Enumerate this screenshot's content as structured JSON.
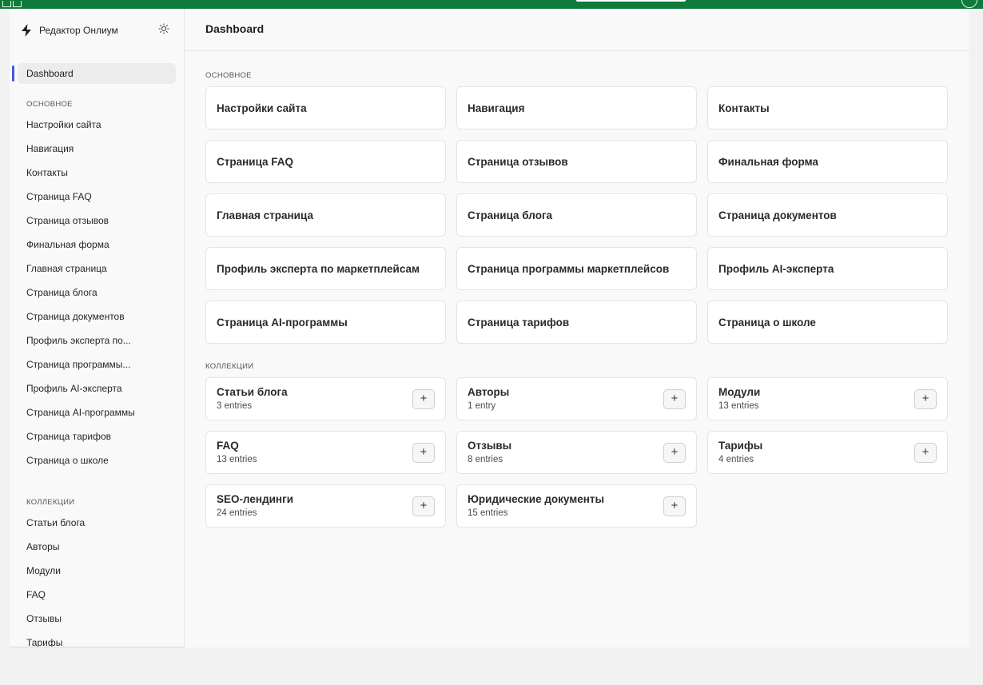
{
  "app": {
    "name": "Редактор Онлиум"
  },
  "header": {
    "title": "Dashboard"
  },
  "sidebar": {
    "active_item": "Dashboard",
    "section_main": "ОСНОВНОЕ",
    "main_items": [
      "Настройки сайта",
      "Навигация",
      "Контакты",
      "Страница FAQ",
      "Страница отзывов",
      "Финальная форма",
      "Главная страница",
      "Страница блога",
      "Страница документов",
      "Профиль эксперта по...",
      "Страница программы...",
      "Профиль AI-эксперта",
      "Страница AI-программы",
      "Страница тарифов",
      "Страница о школе"
    ],
    "section_collections": "КОЛЛЕКЦИИ",
    "collection_items": [
      "Статьи блога",
      "Авторы",
      "Модули",
      "FAQ",
      "Отзывы",
      "Тарифы"
    ]
  },
  "main": {
    "section_main": "ОСНОВНОЕ",
    "pages": [
      "Настройки сайта",
      "Навигация",
      "Контакты",
      "Страница FAQ",
      "Страница отзывов",
      "Финальная форма",
      "Главная страница",
      "Страница блога",
      "Страница документов",
      "Профиль эксперта по маркетплейсам",
      "Страница программы маркетплейсов",
      "Профиль AI-эксперта",
      "Страница AI-программы",
      "Страница тарифов",
      "Страница о школе"
    ],
    "section_collections": "КОЛЛЕКЦИИ",
    "add_label": "+",
    "collections": [
      {
        "title": "Статьи блога",
        "count": "3 entries"
      },
      {
        "title": "Авторы",
        "count": "1 entry"
      },
      {
        "title": "Модули",
        "count": "13 entries"
      },
      {
        "title": "FAQ",
        "count": "13 entries"
      },
      {
        "title": "Отзывы",
        "count": "8 entries"
      },
      {
        "title": "Тарифы",
        "count": "4 entries"
      },
      {
        "title": "SEO-лендинги",
        "count": "24 entries"
      },
      {
        "title": "Юридические документы",
        "count": "15 entries"
      }
    ]
  },
  "colors": {
    "accent": "#3f5bd9",
    "topbar": "#0f7a3b"
  }
}
